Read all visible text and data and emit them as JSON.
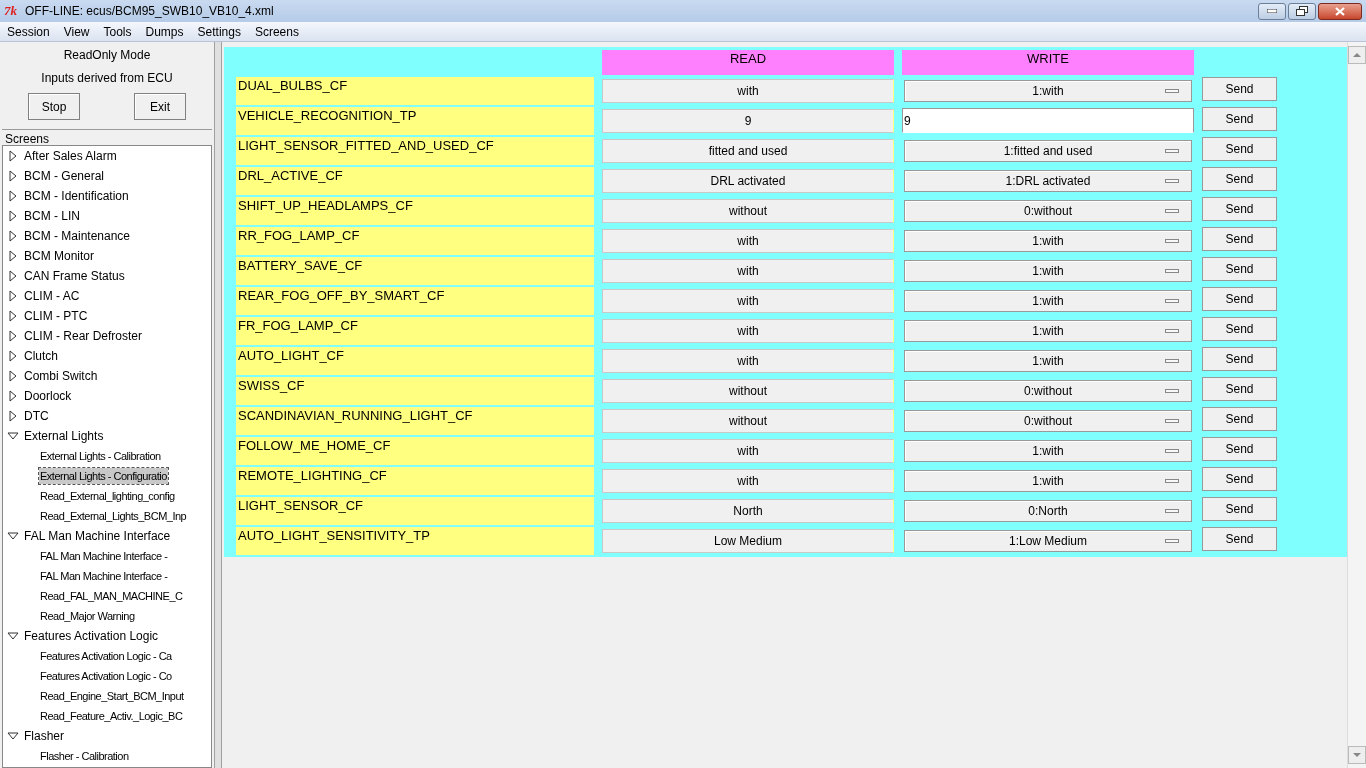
{
  "window": {
    "title": "OFF-LINE: ecus/BCM95_SWB10_VB10_4.xml",
    "icon_text": "7k"
  },
  "menu": [
    "Session",
    "View",
    "Tools",
    "Dumps",
    "Settings",
    "Screens"
  ],
  "mode": {
    "title": "ReadOnly Mode",
    "subtitle": "Inputs derived from ECU",
    "buttons": [
      "Stop",
      "Exit"
    ]
  },
  "screens": {
    "title": "Screens",
    "items": [
      {
        "label": "After Sales Alarm",
        "expanded": false,
        "selected": false
      },
      {
        "label": "BCM - General",
        "expanded": false,
        "selected": false
      },
      {
        "label": "BCM - Identification",
        "expanded": false,
        "selected": false
      },
      {
        "label": "BCM - LIN",
        "expanded": false,
        "selected": false
      },
      {
        "label": "BCM - Maintenance",
        "expanded": false,
        "selected": false
      },
      {
        "label": "BCM Monitor",
        "expanded": false,
        "selected": false
      },
      {
        "label": "CAN Frame Status",
        "expanded": false,
        "selected": false
      },
      {
        "label": "CLIM - AC",
        "expanded": false,
        "selected": false
      },
      {
        "label": "CLIM - PTC",
        "expanded": false,
        "selected": false
      },
      {
        "label": "CLIM - Rear Defroster",
        "expanded": false,
        "selected": false
      },
      {
        "label": "Clutch",
        "expanded": false,
        "selected": false
      },
      {
        "label": "Combi Switch",
        "expanded": false,
        "selected": false
      },
      {
        "label": "Doorlock",
        "expanded": false,
        "selected": false
      },
      {
        "label": "DTC",
        "expanded": false,
        "selected": false
      },
      {
        "label": "External Lights",
        "expanded": true,
        "selected": false,
        "children": [
          {
            "label": "External Lights - Calibration",
            "selected": false
          },
          {
            "label": "External Lights - Configuratio",
            "selected": true
          },
          {
            "label": "Read_External_lighting_config",
            "selected": false
          },
          {
            "label": "Read_External_Lights_BCM_Inp",
            "selected": false
          }
        ]
      },
      {
        "label": "FAL Man Machine Interface",
        "expanded": true,
        "selected": false,
        "children": [
          {
            "label": "FAL Man Machine Interface -",
            "selected": false
          },
          {
            "label": "FAL Man Machine Interface -",
            "selected": false
          },
          {
            "label": "Read_FAL_MAN_MACHINE_C",
            "selected": false
          },
          {
            "label": "Read_Major Warning",
            "selected": false
          }
        ]
      },
      {
        "label": "Features Activation Logic",
        "expanded": true,
        "selected": false,
        "children": [
          {
            "label": "Features Activation Logic - Ca",
            "selected": false
          },
          {
            "label": "Features Activation Logic - Co",
            "selected": false
          },
          {
            "label": "Read_Engine_Start_BCM_Input",
            "selected": false
          },
          {
            "label": "Read_Feature_Activ._Logic_BC",
            "selected": false
          }
        ]
      },
      {
        "label": "Flasher",
        "expanded": true,
        "selected": false,
        "children": [
          {
            "label": "Flasher - Calibration",
            "selected": false
          }
        ]
      }
    ]
  },
  "table": {
    "columns": [
      "READ",
      "WRITE"
    ],
    "rows": [
      {
        "name": "DUAL_BULBS_CF",
        "read": "with",
        "write": {
          "kind": "dropdown",
          "value": "1:with"
        },
        "send": "Send"
      },
      {
        "name": "VEHICLE_RECOGNITION_TP",
        "read": "9",
        "write": {
          "kind": "text",
          "value": "9"
        },
        "send": "Send"
      },
      {
        "name": "LIGHT_SENSOR_FITTED_AND_USED_CF",
        "read": "fitted and used",
        "write": {
          "kind": "dropdown",
          "value": "1:fitted and used"
        },
        "send": "Send"
      },
      {
        "name": "DRL_ACTIVE_CF",
        "read": "DRL activated",
        "write": {
          "kind": "dropdown",
          "value": "1:DRL activated"
        },
        "send": "Send"
      },
      {
        "name": "SHIFT_UP_HEADLAMPS_CF",
        "read": "without",
        "write": {
          "kind": "dropdown",
          "value": "0:without"
        },
        "send": "Send"
      },
      {
        "name": "RR_FOG_LAMP_CF",
        "read": "with",
        "write": {
          "kind": "dropdown",
          "value": "1:with"
        },
        "send": "Send"
      },
      {
        "name": "BATTERY_SAVE_CF",
        "read": "with",
        "write": {
          "kind": "dropdown",
          "value": "1:with"
        },
        "send": "Send"
      },
      {
        "name": "REAR_FOG_OFF_BY_SMART_CF",
        "read": "with",
        "write": {
          "kind": "dropdown",
          "value": "1:with"
        },
        "send": "Send"
      },
      {
        "name": "FR_FOG_LAMP_CF",
        "read": "with",
        "write": {
          "kind": "dropdown",
          "value": "1:with"
        },
        "send": "Send"
      },
      {
        "name": "AUTO_LIGHT_CF",
        "read": "with",
        "write": {
          "kind": "dropdown",
          "value": "1:with"
        },
        "send": "Send"
      },
      {
        "name": "SWISS_CF",
        "read": "without",
        "write": {
          "kind": "dropdown",
          "value": "0:without"
        },
        "send": "Send"
      },
      {
        "name": "SCANDINAVIAN_RUNNING_LIGHT_CF",
        "read": "without",
        "write": {
          "kind": "dropdown",
          "value": "0:without"
        },
        "send": "Send"
      },
      {
        "name": "FOLLOW_ME_HOME_CF",
        "read": "with",
        "write": {
          "kind": "dropdown",
          "value": "1:with"
        },
        "send": "Send"
      },
      {
        "name": "REMOTE_LIGHTING_CF",
        "read": "with",
        "write": {
          "kind": "dropdown",
          "value": "1:with"
        },
        "send": "Send"
      },
      {
        "name": "LIGHT_SENSOR_CF",
        "read": "North",
        "write": {
          "kind": "dropdown",
          "value": "0:North"
        },
        "send": "Send"
      },
      {
        "name": "AUTO_LIGHT_SENSITIVITY_TP",
        "read": "Low Medium",
        "write": {
          "kind": "dropdown",
          "value": "1:Low Medium"
        },
        "send": "Send"
      }
    ]
  }
}
